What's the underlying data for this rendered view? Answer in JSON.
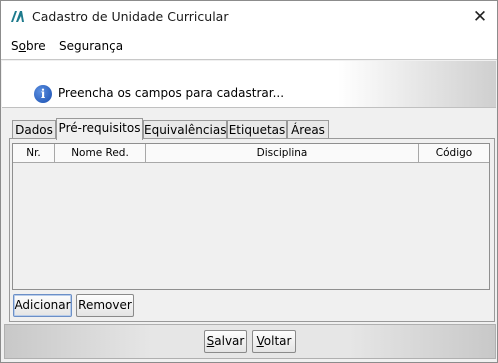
{
  "window": {
    "title": "Cadastro de Unidade Curricular",
    "icon": "app-logo-icon",
    "close_glyph": "✕"
  },
  "menu": {
    "items": [
      {
        "label_prefix": "S",
        "label_mnemonic": "o",
        "label_suffix": "bre"
      },
      {
        "label_prefix": "",
        "label_mnemonic": "",
        "label_suffix": "Segurança"
      }
    ]
  },
  "banner": {
    "icon": "info-icon",
    "message": "Preencha os campos para cadastrar..."
  },
  "tabs": [
    {
      "label": "Dados",
      "active": false
    },
    {
      "label": "Pré-requisitos",
      "active": true
    },
    {
      "label": "Equivalências",
      "active": false
    },
    {
      "label": "Etiquetas",
      "active": false
    },
    {
      "label": "Áreas",
      "active": false
    }
  ],
  "table": {
    "columns": [
      "Nr.",
      "Nome Red.",
      "Disciplina",
      "Código"
    ],
    "rows": []
  },
  "panel_buttons": {
    "add": "Adicionar",
    "remove": "Remover"
  },
  "footer_buttons": {
    "save": {
      "mnemonic": "S",
      "rest": "alvar"
    },
    "back": {
      "mnemonic": "V",
      "rest": "oltar"
    }
  },
  "colors": {
    "info_icon": "#1a4fb0",
    "window_bg": "#f0f0f0",
    "focus_border": "#6b8fc7"
  }
}
